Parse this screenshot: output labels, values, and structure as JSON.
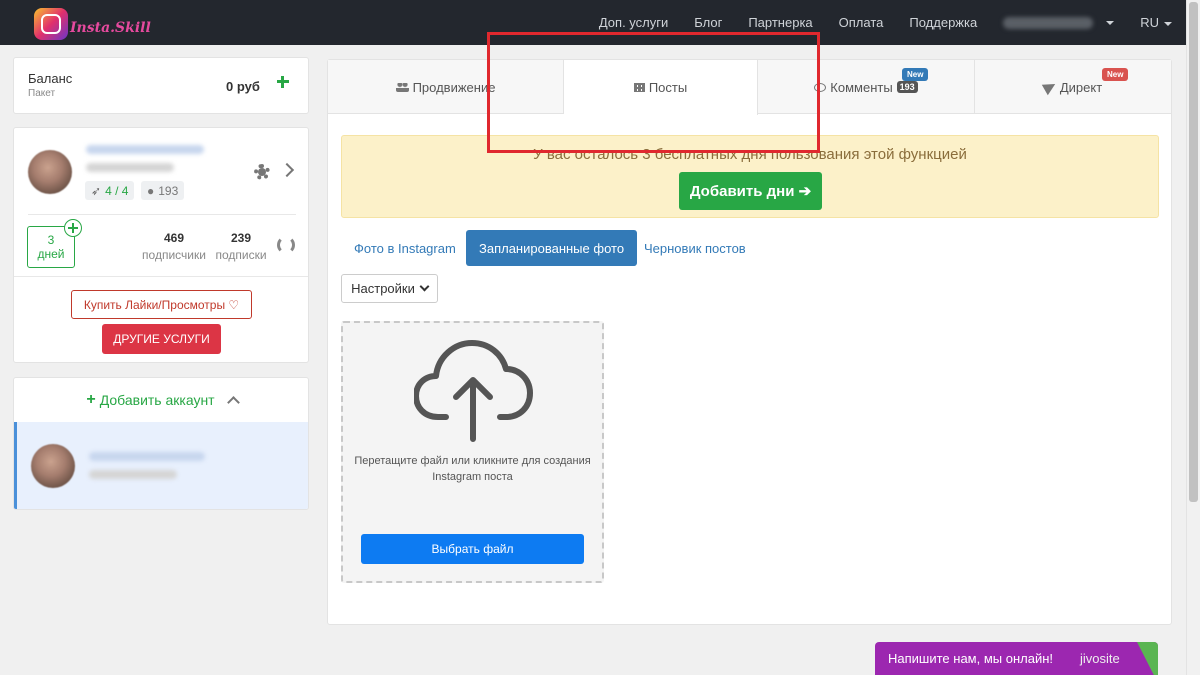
{
  "nav": {
    "logo_text": "Insta.Skill",
    "links": [
      "Доп. услуги",
      "Блог",
      "Партнерка",
      "Оплата",
      "Поддержка"
    ],
    "language": "RU"
  },
  "sidebar": {
    "balance_label": "Баланс",
    "package_label": "Пакет",
    "balance_amount": "0 руб",
    "profile": {
      "posts_stat": "4 / 4",
      "comments_stat": "193",
      "days_number": "3",
      "days_label": "дней",
      "followers_count": "469",
      "followers_label": "подписчики",
      "following_count": "239",
      "following_label": "подписки",
      "buy_button": "Купить Лайки/Просмотры ♡",
      "other_services_button": "ДРУГИЕ УСЛУГИ"
    },
    "add_account": "Добавить аккаунт"
  },
  "main": {
    "tabs": [
      {
        "label": "Продвижение"
      },
      {
        "label": "Посты"
      },
      {
        "label": "Комменты",
        "count": "193",
        "badge": "New"
      },
      {
        "label": "Директ",
        "badge": "New"
      }
    ],
    "alert_text": "У вас осталось 3 бесплатных дня пользования этой функцией",
    "add_days_button": "Добавить дни ➔",
    "subtabs": [
      "Фото в Instagram",
      "Запланированные фото",
      "Черновик постов"
    ],
    "settings_button": "Настройки",
    "upload_text_line1": "Перетащите файл или кликните для создания",
    "upload_text_line2": "Instagram поста",
    "choose_file_button": "Выбрать файл"
  },
  "chat_widget": {
    "text": "Напишите нам, мы онлайн!",
    "brand": "jivosite"
  },
  "colors": {
    "navbar": "#23272e",
    "green": "#28a745",
    "red": "#dc3545",
    "blue": "#337ab7",
    "file_button": "#0d7bf2",
    "alert_bg": "#fcf1c9",
    "chat_bg": "#9c27b0"
  }
}
